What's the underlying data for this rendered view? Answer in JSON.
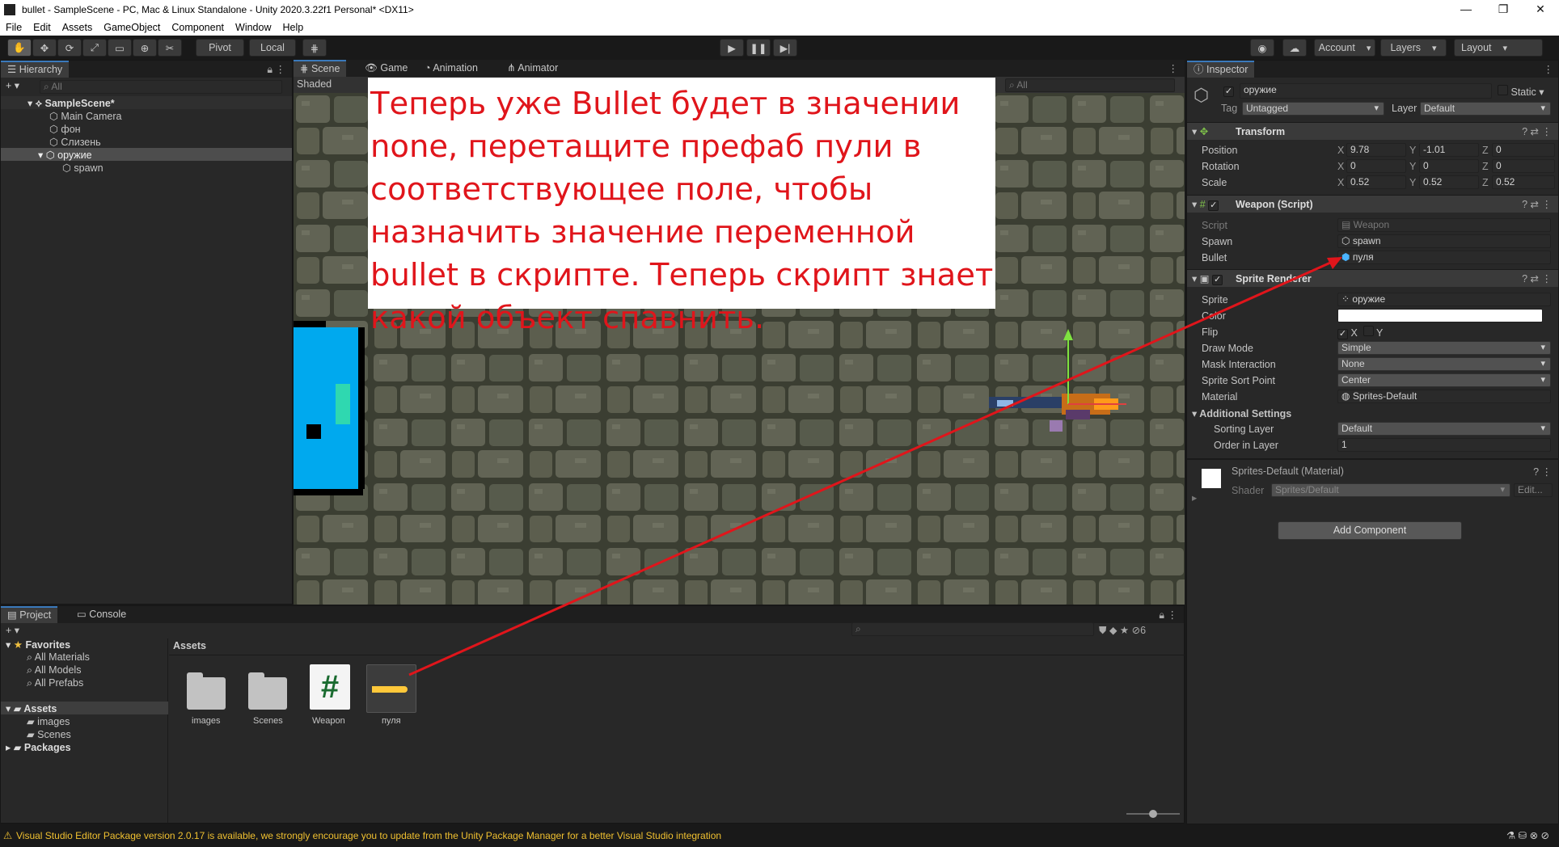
{
  "window": {
    "title": "bullet - SampleScene - PC, Mac & Linux Standalone - Unity 2020.3.22f1 Personal* <DX11>",
    "buttons": [
      "—",
      "❐",
      "✕"
    ]
  },
  "menu": [
    "File",
    "Edit",
    "Assets",
    "GameObject",
    "Component",
    "Window",
    "Help"
  ],
  "toolbar": {
    "pivot": "Pivot",
    "local": "Local",
    "account": "Account",
    "layers": "Layers",
    "layout": "Layout"
  },
  "hierarchy": {
    "tab": "Hierarchy",
    "search_placeholder": "All",
    "scene": "SampleScene*",
    "items": [
      "Main Camera",
      "фон",
      "Слизень",
      "оружие",
      "spawn"
    ]
  },
  "scene": {
    "tabs": [
      "Scene",
      "Game",
      "Animation",
      "Animator"
    ],
    "shading": "Shaded",
    "search_placeholder": "All",
    "annotation": "Теперь уже Bullet будет в значении none, перетащите префаб пули в соответствующее поле, чтобы назначить значение переменной bullet в скрипте. Теперь скрипт знает какой объект спавнить."
  },
  "inspector": {
    "tab": "Inspector",
    "object_name": "оружие",
    "static_label": "Static",
    "tag_label": "Tag",
    "tag_value": "Untagged",
    "layer_label": "Layer",
    "layer_value": "Default",
    "transform": {
      "title": "Transform",
      "rows": [
        {
          "label": "Position",
          "x": "9.78",
          "y": "-1.01",
          "z": "0"
        },
        {
          "label": "Rotation",
          "x": "0",
          "y": "0",
          "z": "0"
        },
        {
          "label": "Scale",
          "x": "0.52",
          "y": "0.52",
          "z": "0.52"
        }
      ]
    },
    "weapon": {
      "title": "Weapon (Script)",
      "script_label": "Script",
      "script_value": "Weapon",
      "spawn_label": "Spawn",
      "spawn_value": "spawn",
      "bullet_label": "Bullet",
      "bullet_value": "пуля"
    },
    "sprite_renderer": {
      "title": "Sprite Renderer",
      "sprite_label": "Sprite",
      "sprite_value": "оружие",
      "color_label": "Color",
      "flip_label": "Flip",
      "flip_x": "X",
      "flip_y": "Y",
      "draw_mode_label": "Draw Mode",
      "draw_mode_value": "Simple",
      "mask_label": "Mask Interaction",
      "mask_value": "None",
      "sort_point_label": "Sprite Sort Point",
      "sort_point_value": "Center",
      "material_label": "Material",
      "material_value": "Sprites-Default",
      "additional_label": "Additional Settings",
      "sorting_layer_label": "Sorting Layer",
      "sorting_layer_value": "Default",
      "order_label": "Order in Layer",
      "order_value": "1"
    },
    "material": {
      "title": "Sprites-Default (Material)",
      "shader_label": "Shader",
      "shader_value": "Sprites/Default",
      "edit": "Edit..."
    },
    "add_component": "Add Component"
  },
  "project": {
    "tabs": [
      "Project",
      "Console"
    ],
    "favorites": "Favorites",
    "fav_items": [
      "All Materials",
      "All Models",
      "All Prefabs"
    ],
    "assets": "Assets",
    "asset_folders": [
      "images",
      "Scenes"
    ],
    "packages": "Packages",
    "breadcrumb": "Assets",
    "hidden_count": "6",
    "grid": [
      "images",
      "Scenes",
      "Weapon",
      "пуля"
    ]
  },
  "status": {
    "message": "Visual Studio Editor Package version 2.0.17 is available, we strongly encourage you to update from the Unity Package Manager for a better Visual Studio integration"
  },
  "colors": {
    "accent": "#3a79bb",
    "annotation_red": "#e0151b",
    "sky_blue": "#00a9ee"
  }
}
